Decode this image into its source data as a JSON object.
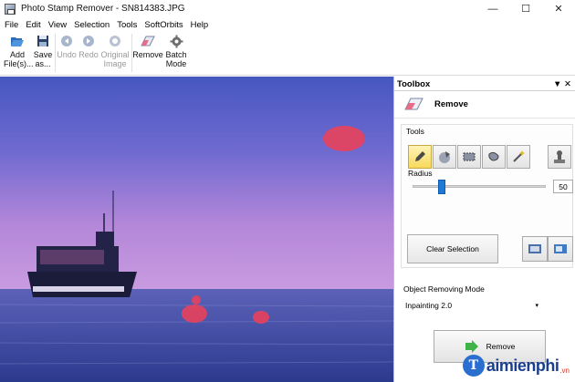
{
  "window": {
    "title": "Photo Stamp Remover - SN814383.JPG",
    "controls": [
      "—",
      "☐",
      "✕"
    ]
  },
  "menu": [
    "File",
    "Edit",
    "View",
    "Selection",
    "Tools",
    "SoftOrbits",
    "Help"
  ],
  "toolbar": {
    "add_files": "Add File(s)...",
    "save_as": "Save as...",
    "undo": "Undo",
    "redo": "Redo",
    "original_image": "Original Image",
    "remove": "Remove",
    "batch_mode": "Batch Mode"
  },
  "toolbox": {
    "header": "Toolbox",
    "pin": "▼ ✕",
    "title": "Remove",
    "tools_label": "Tools",
    "radius_label": "Radius",
    "radius_value": "50",
    "radius_fraction": 0.2,
    "clear_selection": "Clear Selection",
    "mode_label": "Object Removing Mode",
    "mode_value": "Inpainting 2.0",
    "remove_button": "Remove"
  },
  "watermark": {
    "brand": "aimienphi",
    "suffix": ".vn"
  },
  "colors": {
    "selection": "#e8415b",
    "sky_top": "#4a5cc4",
    "sky_mid": "#b07ad8",
    "sea": "#3a4aa0",
    "active_tool": "#f7d95a",
    "slider": "#1e79d7"
  }
}
